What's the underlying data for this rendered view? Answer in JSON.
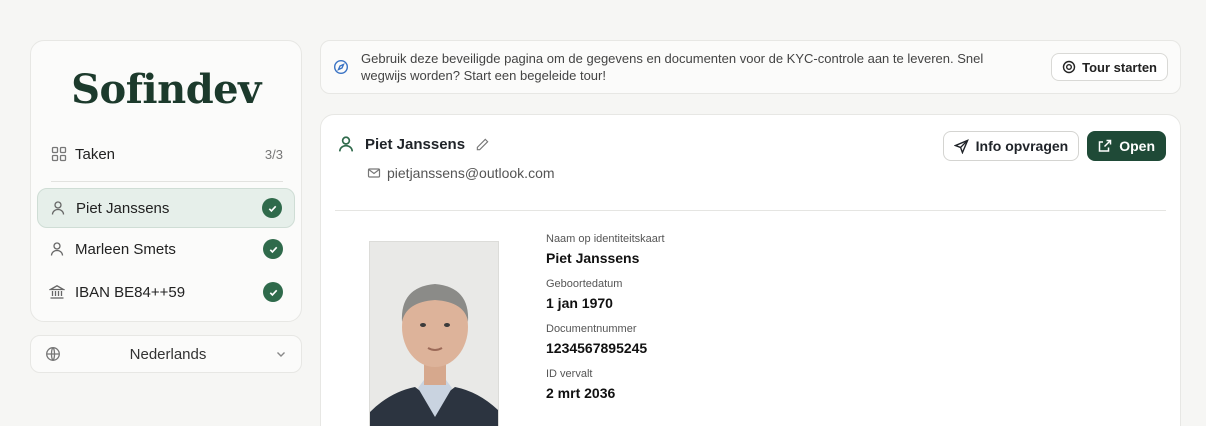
{
  "sidebar": {
    "logo": "Sofindev",
    "tasks": {
      "label": "Taken",
      "count": "3/3",
      "icon": "grid-icon"
    },
    "items": [
      {
        "label": "Piet Janssens",
        "icon": "user-icon",
        "status": "complete",
        "active": true
      },
      {
        "label": "Marleen Smets",
        "icon": "user-icon",
        "status": "complete",
        "active": false
      },
      {
        "label": "IBAN BE84++59",
        "icon": "bank-icon",
        "status": "complete",
        "active": false
      }
    ],
    "language": {
      "label": "Nederlands",
      "icon": "globe-icon"
    }
  },
  "banner": {
    "text": "Gebruik deze beveiligde pagina om de gegevens en documenten voor de KYC-controle aan te leveren. Snel wegwijs worden? Start een begeleide tour!",
    "tour_button": "Tour starten",
    "icon": "compass-icon"
  },
  "person": {
    "name": "Piet Janssens",
    "email": "pietjanssens@outlook.com",
    "actions": {
      "info_label": "Info opvragen",
      "open_label": "Open"
    }
  },
  "id_card": {
    "fields": [
      {
        "label": "Naam op identiteitskaart",
        "value": "Piet Janssens"
      },
      {
        "label": "Geboortedatum",
        "value": "1 jan 1970"
      },
      {
        "label": "Documentnummer",
        "value": "1234567895245"
      },
      {
        "label": "ID vervalt",
        "value": "2 mrt 2036"
      }
    ]
  },
  "colors": {
    "brand": "#1c3a2c",
    "primary_button": "#1f4a37",
    "check": "#2f6a4b",
    "active_bg": "#e6efea",
    "info_icon": "#3a73c4"
  }
}
